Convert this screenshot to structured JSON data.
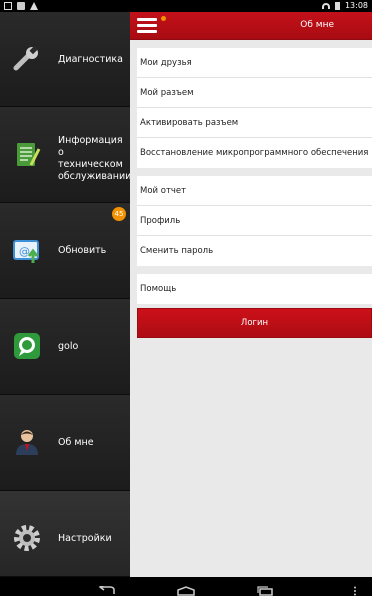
{
  "status_bar": {
    "time": "13:08"
  },
  "sidebar": {
    "items": [
      {
        "label": "Диагностика"
      },
      {
        "label": "Информация о техническом обслуживании"
      },
      {
        "label": "Обновить",
        "badge": "45"
      },
      {
        "label": "golo"
      },
      {
        "label": "Об мне"
      },
      {
        "label": "Настройки"
      }
    ]
  },
  "header": {
    "title": "Об мне"
  },
  "groups": [
    [
      "Мои друзья",
      "Мой разъем",
      "Активировать разъем",
      "Восстановление микропрограммного обеспечения"
    ],
    [
      "Мой отчет",
      "Профиль",
      "Сменить пароль"
    ],
    [
      "Помощь"
    ]
  ],
  "login_button": "Логин",
  "colors": {
    "accent": "#b50e16",
    "badge": "#f39200",
    "sidebar": "#1d1d1d"
  },
  "icons": [
    "wrench-icon",
    "maintenance-doc-icon",
    "update-mail-icon",
    "golo-chat-icon",
    "user-icon",
    "gear-icon"
  ]
}
